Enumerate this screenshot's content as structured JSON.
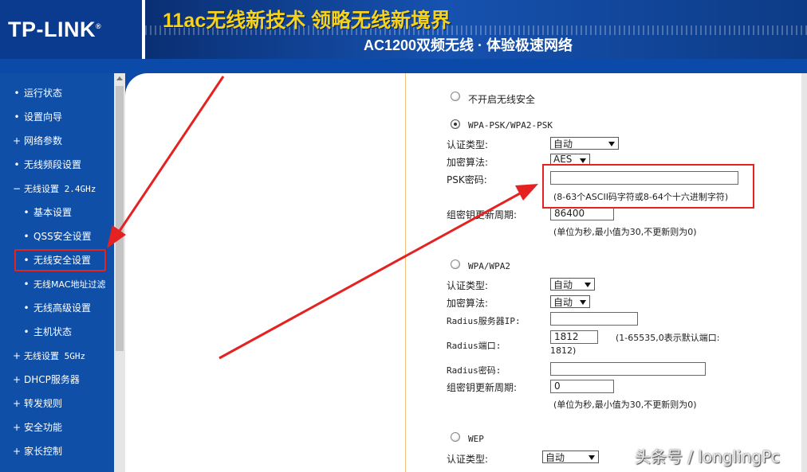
{
  "header": {
    "logo": "TP-LINK",
    "logo_mark": "®",
    "tagline": "11ac无线新技术 领略无线新境界",
    "subline": "AC1200双频无线 · 体验极速网络"
  },
  "sidebar": {
    "items": [
      {
        "marker": "•",
        "label": "运行状态"
      },
      {
        "marker": "•",
        "label": "设置向导"
      },
      {
        "marker": "+",
        "label": "网络参数"
      },
      {
        "marker": "•",
        "label": "无线频段设置"
      },
      {
        "marker": "−",
        "label": "无线设置 2.4GHz"
      },
      {
        "marker": "•",
        "label": "基本设置"
      },
      {
        "marker": "•",
        "label": "QSS安全设置"
      },
      {
        "marker": "•",
        "label": "无线安全设置"
      },
      {
        "marker": "•",
        "label": "无线MAC地址过滤"
      },
      {
        "marker": "•",
        "label": "无线高级设置"
      },
      {
        "marker": "•",
        "label": "主机状态"
      },
      {
        "marker": "+",
        "label": "无线设置 5GHz"
      },
      {
        "marker": "+",
        "label": "DHCP服务器"
      },
      {
        "marker": "+",
        "label": "转发规则"
      },
      {
        "marker": "+",
        "label": "安全功能"
      },
      {
        "marker": "+",
        "label": "家长控制"
      }
    ]
  },
  "form": {
    "option_none": "不开启无线安全",
    "wpa_psk": {
      "title": "WPA-PSK/WPA2-PSK",
      "auth_label": "认证类型:",
      "auth_value": "自动",
      "enc_label": "加密算法:",
      "enc_value": "AES",
      "psk_label": "PSK密码:",
      "psk_value": "",
      "psk_hint": "(8-63个ASCII码字符或8-64个十六进制字符)",
      "renew_label": "组密钥更新周期:",
      "renew_value": "86400",
      "renew_hint": "(单位为秒,最小值为30,不更新则为0)"
    },
    "wpa": {
      "title": "WPA/WPA2",
      "auth_label": "认证类型:",
      "auth_value": "自动",
      "enc_label": "加密算法:",
      "enc_value": "自动",
      "radius_ip_label": "Radius服务器IP:",
      "radius_ip_value": "",
      "radius_port_label": "Radius端口:",
      "radius_port_value": "1812",
      "radius_port_hint": "(1-65535,0表示默认端口:",
      "radius_port_hint2": "1812)",
      "radius_pwd_label": "Radius密码:",
      "radius_pwd_value": "",
      "renew_label": "组密钥更新周期:",
      "renew_value": "0",
      "renew_hint": "(单位为秒,最小值为30,不更新则为0)"
    },
    "wep": {
      "title": "WEP",
      "auth_label": "认证类型:",
      "auth_value": "自动"
    }
  },
  "watermark": "头条号 / longlingPc",
  "colors": {
    "header_blue": "#0c3a8a",
    "sidebar_blue": "#0f4fa8",
    "banner_yellow": "#f7d21b",
    "annotation_red": "#e52222"
  }
}
